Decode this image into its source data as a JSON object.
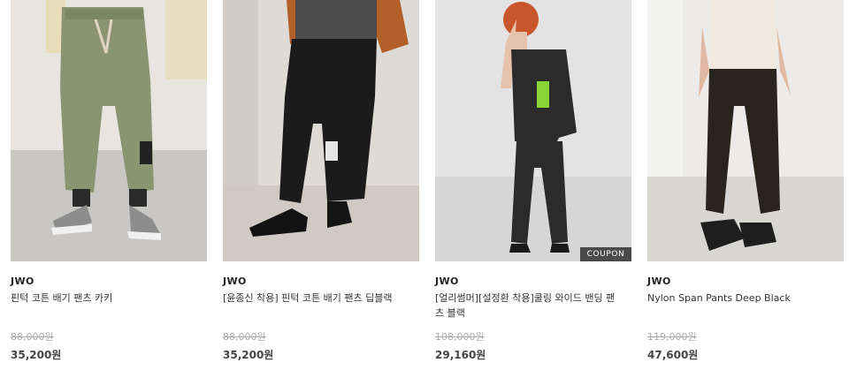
{
  "products": [
    {
      "brand": "JWO",
      "name": "핀턱 코튼 배기 팬츠 카키",
      "original_price": "88,000원",
      "sale_price": "35,200원",
      "badge": ""
    },
    {
      "brand": "JWO",
      "name": "[윤종신 착용] 핀턱 코튼 배기 팬츠 딥블랙",
      "original_price": "88,000원",
      "sale_price": "35,200원",
      "badge": ""
    },
    {
      "brand": "JWO",
      "name": "[얼리썸머][설정환 착용]쿨링 와이드 밴딩 팬츠 블랙",
      "original_price": "108,000원",
      "sale_price": "29,160원",
      "badge": "COUPON"
    },
    {
      "brand": "JWO",
      "name": "Nylon Span Pants Deep Black",
      "original_price": "119,000원",
      "sale_price": "47,600원",
      "badge": ""
    }
  ]
}
